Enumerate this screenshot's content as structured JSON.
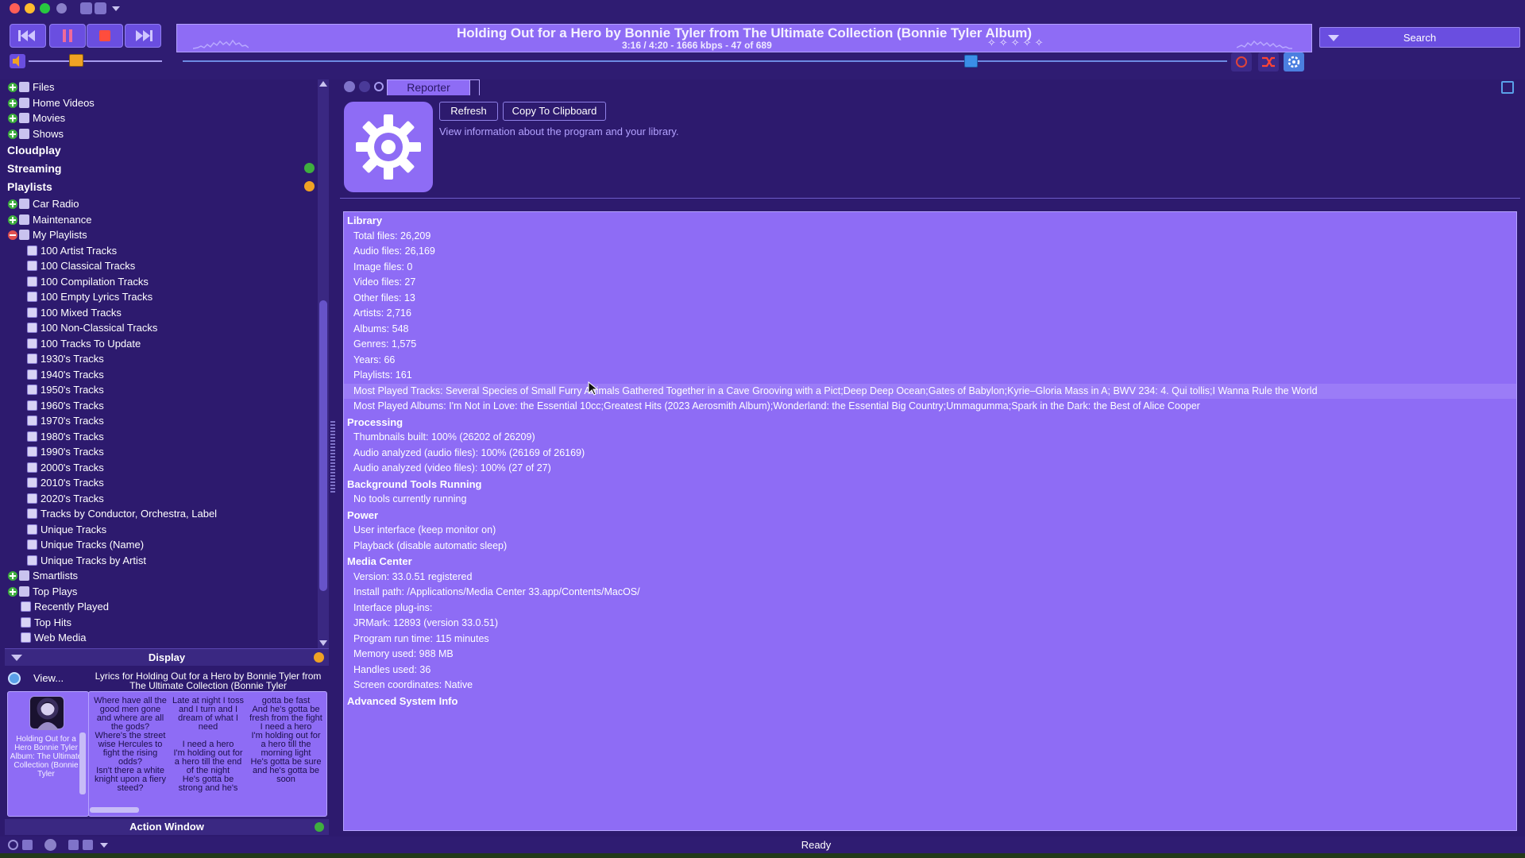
{
  "player": {
    "now_playing_title": "Holding Out for a Hero by Bonnie Tyler from The Ultimate Collection (Bonnie Tyler Album)",
    "now_playing_info": "3:16 / 4:20 - 1666 kbps -  47 of 689",
    "rating_stars": "✧✧✧✧✧",
    "search_label": "Search",
    "volume_fraction": 0.36,
    "seek_fraction": 0.754
  },
  "tree": {
    "top_items": [
      "Files",
      "Home Videos",
      "Movies",
      "Shows"
    ],
    "sections": {
      "cloudplay": "Cloudplay",
      "streaming": "Streaming",
      "playlists": "Playlists"
    },
    "playlist_groups": [
      "Car Radio",
      "Maintenance",
      "My Playlists"
    ],
    "my_playlists": [
      "100 Artist Tracks",
      "100 Classical Tracks",
      "100 Compilation Tracks",
      "100 Empty Lyrics Tracks",
      "100 Mixed Tracks",
      "100 Non-Classical Tracks",
      "100 Tracks To Update",
      "1930's Tracks",
      "1940's Tracks",
      "1950's Tracks",
      "1960's Tracks",
      "1970's Tracks",
      "1980's Tracks",
      "1990's Tracks",
      "2000's Tracks",
      "2010's Tracks",
      "2020's Tracks",
      "Tracks by Conductor, Orchestra, Label",
      "Unique Tracks",
      "Unique Tracks (Name)",
      "Unique Tracks by Artist"
    ],
    "after_groups": [
      "Smartlists",
      "Top Plays"
    ],
    "top_plays_items": [
      "Recently Played",
      "Top Hits",
      "Web Media"
    ]
  },
  "display": {
    "header": "Display",
    "view_button": "View...",
    "cover_caption": "Holding Out for a Hero Bonnie Tyler Album: The Ultimate Collection (Bonnie Tyler",
    "lyrics_title": "Lyrics for Holding Out for a Hero by Bonnie Tyler from The Ultimate Collection (Bonnie Tyler",
    "lyrics_columns": [
      "Where have all the good men gone and where are all the gods?\nWhere's the street wise Hercules to fight the rising odds?\nIsn't there a white knight upon a fiery steed?",
      "Late at night I toss and I turn and I dream of what I need\n\nI need a hero\nI'm holding out for a hero till the end of the night\nHe's gotta be strong and he's",
      "gotta be fast\nAnd he's gotta be fresh from the fight\nI need a hero\nI'm holding out for a hero till the morning light\nHe's gotta be sure and he's gotta be soon"
    ],
    "action_window": "Action Window"
  },
  "status": {
    "text": "Ready"
  },
  "reporter": {
    "tab_label": "Reporter",
    "refresh_button": "Refresh",
    "copy_button": "Copy To Clipboard",
    "description": "View information about the program and your library.",
    "lines": [
      {
        "type": "section",
        "text": "Library"
      },
      {
        "type": "item",
        "text": "Total files: 26,209"
      },
      {
        "type": "item",
        "text": "Audio files: 26,169"
      },
      {
        "type": "item",
        "text": "Image files: 0"
      },
      {
        "type": "item",
        "text": "Video files: 27"
      },
      {
        "type": "item",
        "text": "Other files: 13"
      },
      {
        "type": "item",
        "text": "Artists: 2,716"
      },
      {
        "type": "item",
        "text": "Albums: 548"
      },
      {
        "type": "item",
        "text": "Genres: 1,575"
      },
      {
        "type": "item",
        "text": "Years: 66"
      },
      {
        "type": "item",
        "text": "Playlists: 161"
      },
      {
        "type": "item",
        "text": "Most Played Tracks: Several Species of Small Furry Animals Gathered Together in a Cave Grooving with a Pict;Deep Deep Ocean;Gates of Babylon;Kyrie–Gloria Mass in A; BWV 234: 4. Qui tollis;I Wanna Rule the World",
        "highlight": true
      },
      {
        "type": "item",
        "text": "Most Played Albums: I'm Not in Love: the Essential 10cc;Greatest Hits (2023 Aerosmith Album);Wonderland: the Essential Big Country;Ummagumma;Spark in the Dark: the Best of Alice Cooper"
      },
      {
        "type": "section",
        "text": "Processing"
      },
      {
        "type": "item",
        "text": "Thumbnails built: 100% (26202 of 26209)"
      },
      {
        "type": "item",
        "text": "Audio analyzed (audio files): 100% (26169 of 26169)"
      },
      {
        "type": "item",
        "text": "Audio analyzed (video files): 100% (27 of 27)"
      },
      {
        "type": "section",
        "text": "Background Tools Running"
      },
      {
        "type": "item",
        "text": "No tools currently running"
      },
      {
        "type": "section",
        "text": "Power"
      },
      {
        "type": "item",
        "text": "User interface (keep monitor on)"
      },
      {
        "type": "item",
        "text": "Playback (disable automatic sleep)"
      },
      {
        "type": "section",
        "text": "Media Center"
      },
      {
        "type": "item",
        "text": "Version: 33.0.51 registered"
      },
      {
        "type": "item",
        "text": "Install path: /Applications/Media Center 33.app/Contents/MacOS/"
      },
      {
        "type": "item",
        "text": "Interface plug-ins:"
      },
      {
        "type": "item",
        "text": "JRMark: 12893 (version 33.0.51)"
      },
      {
        "type": "item",
        "text": "Program run time: 115 minutes"
      },
      {
        "type": "item",
        "text": "Memory used: 988 MB"
      },
      {
        "type": "item",
        "text": "Handles used: 36"
      },
      {
        "type": "item",
        "text": "Screen coordinates: Native"
      },
      {
        "type": "section",
        "text": "Advanced System Info"
      }
    ]
  },
  "colors": {
    "background": "#2d1a6e",
    "panel": "#8e6cf5",
    "accent_orange": "#f0a224",
    "accent_blue": "#3a8ee8",
    "highlight_text": "#b3a2ff"
  }
}
